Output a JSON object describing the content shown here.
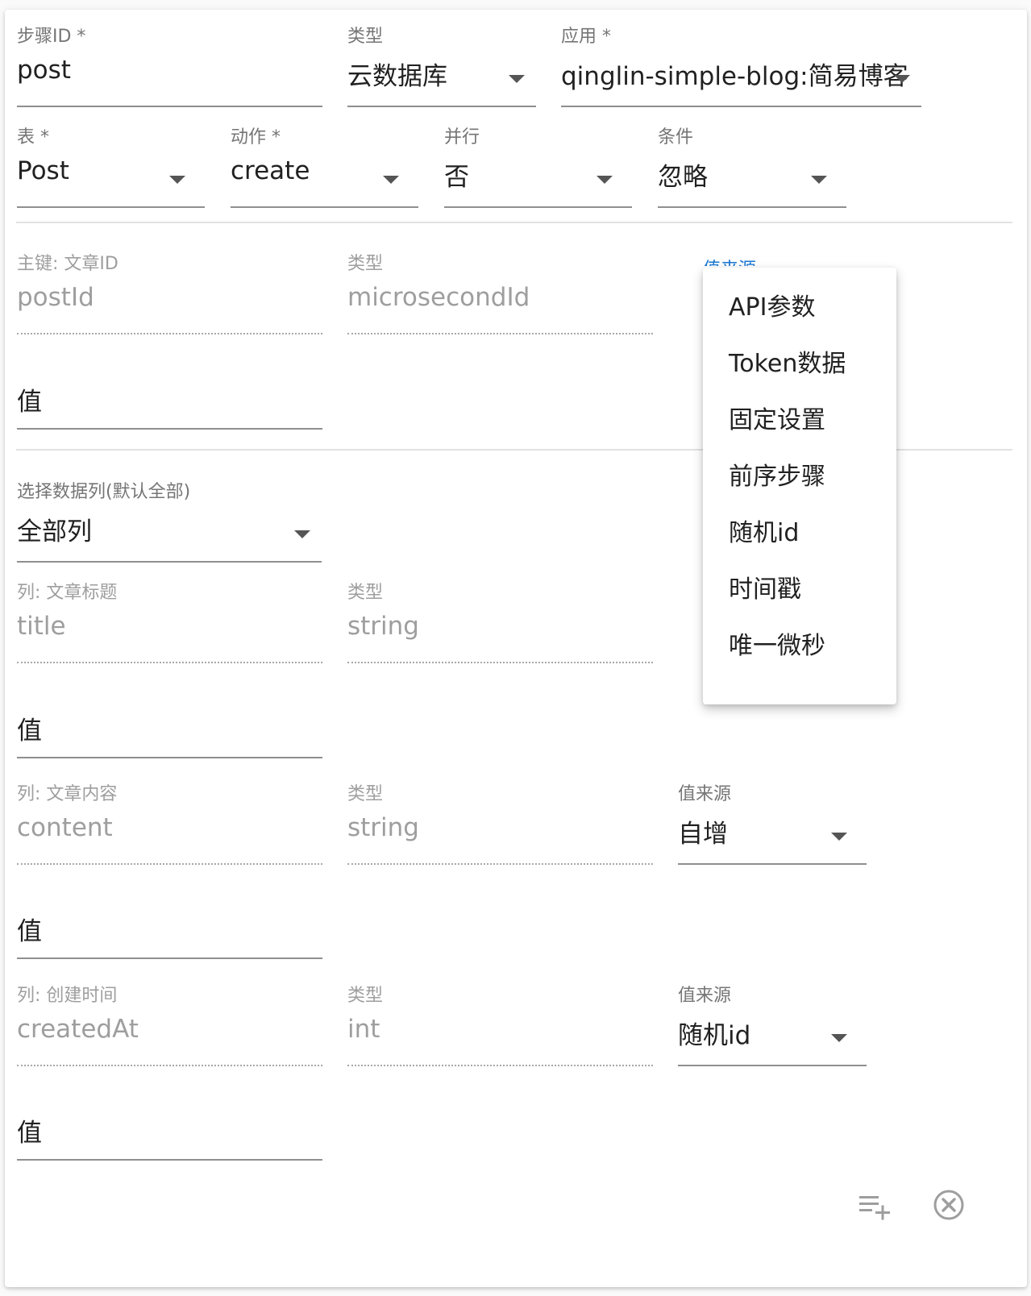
{
  "row1": {
    "step_id": {
      "label": "步骤ID *",
      "value": "post"
    },
    "type": {
      "label": "类型",
      "value": "云数据库"
    },
    "app": {
      "label": "应用 *",
      "value": "qinglin-simple-blog:简易博客"
    }
  },
  "row2": {
    "table": {
      "label": "表 *",
      "value": "Post"
    },
    "action": {
      "label": "动作 *",
      "value": "create"
    },
    "parallel": {
      "label": "并行",
      "value": "否"
    },
    "condition": {
      "label": "条件",
      "value": "忽略"
    }
  },
  "primary_key": {
    "column_label": "主键: 文章ID",
    "column_value": "postId",
    "type_label": "类型",
    "type_value": "microsecondId",
    "source_label": "值来源",
    "value_label": "值"
  },
  "select_columns": {
    "label": "选择数据列(默认全部)",
    "value": "全部列"
  },
  "columns": [
    {
      "column_label": "列: 文章标题",
      "column_value": "title",
      "type_label": "类型",
      "type_value": "string",
      "value_label": "值"
    },
    {
      "column_label": "列: 文章内容",
      "column_value": "content",
      "type_label": "类型",
      "type_value": "string",
      "source_label": "值来源",
      "source_value": "自增",
      "value_label": "值"
    },
    {
      "column_label": "列: 创建时间",
      "column_value": "createdAt",
      "type_label": "类型",
      "type_value": "int",
      "source_label": "值来源",
      "source_value": "随机id",
      "value_label": "值"
    }
  ],
  "source_menu": {
    "items": [
      "API参数",
      "Token数据",
      "固定设置",
      "前序步骤",
      "随机id",
      "时间戳",
      "唯一微秒"
    ]
  },
  "footer": {
    "add_icon": "playlist-add-icon",
    "close_icon": "close-circle-icon"
  },
  "colors": {
    "accent": "#1976d2",
    "label": "#757575",
    "disabled": "#9e9e9e",
    "icon": "#9e9e9e"
  }
}
